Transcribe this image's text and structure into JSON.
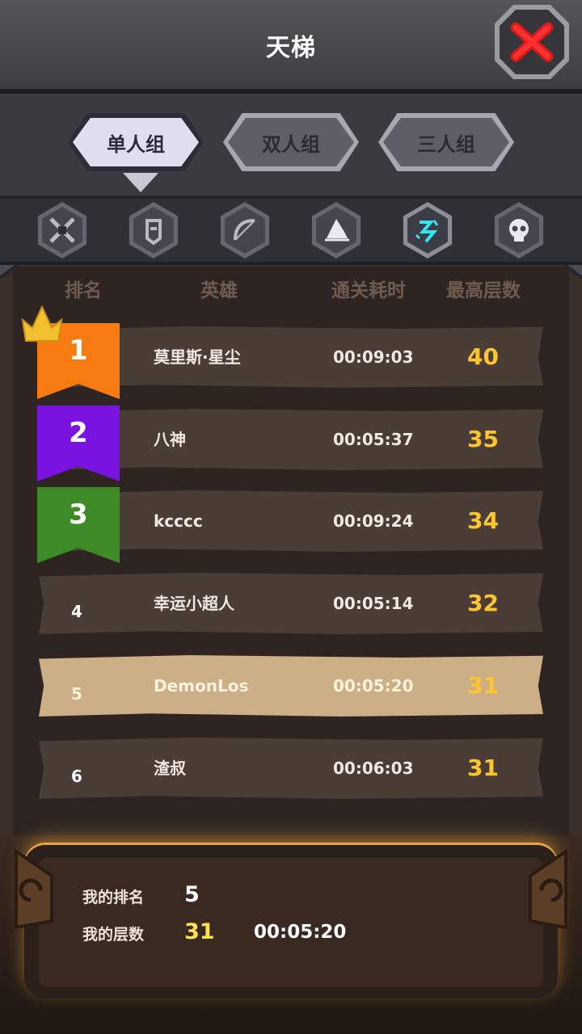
{
  "header": {
    "title": "天梯"
  },
  "tabs": [
    {
      "label": "单人组",
      "active": true
    },
    {
      "label": "双人组",
      "active": false
    },
    {
      "label": "三人组",
      "active": false
    }
  ],
  "hero_icons": [
    {
      "icon": "crossed-blades-icon",
      "selected": false
    },
    {
      "icon": "helmet-warrior-icon",
      "selected": false
    },
    {
      "icon": "bow-icon",
      "selected": false
    },
    {
      "icon": "witch-hat-icon",
      "selected": false
    },
    {
      "icon": "cyan-rune-icon",
      "selected": true
    },
    {
      "icon": "skull-icon",
      "selected": false
    }
  ],
  "columns": {
    "rank": "排名",
    "hero": "英雄",
    "time": "通关耗时",
    "floor": "最高层数"
  },
  "rows": [
    {
      "rank": "1",
      "hero": "莫里斯·星尘",
      "time": "00:09:03",
      "floor": "40",
      "ribbon_color": "#f77b11"
    },
    {
      "rank": "2",
      "hero": "八神",
      "time": "00:05:37",
      "floor": "35",
      "ribbon_color": "#7a12e0"
    },
    {
      "rank": "3",
      "hero": "kcccc",
      "time": "00:09:24",
      "floor": "34",
      "ribbon_color": "#3d8a26"
    },
    {
      "rank": "4",
      "hero": "幸运小超人",
      "time": "00:05:14",
      "floor": "32"
    },
    {
      "rank": "5",
      "hero": "DemonLos",
      "time": "00:05:20",
      "floor": "31",
      "is_me": true
    },
    {
      "rank": "6",
      "hero": "渣叔",
      "time": "00:06:03",
      "floor": "31"
    }
  ],
  "footer": {
    "my_rank_label": "我的排名",
    "my_rank": "5",
    "my_floor_label": "我的层数",
    "my_floor": "31",
    "my_time": "00:05:20"
  },
  "colors": {
    "gold": "#ffc52e",
    "me_row": "#ccae87",
    "row": "#4a3d36"
  }
}
